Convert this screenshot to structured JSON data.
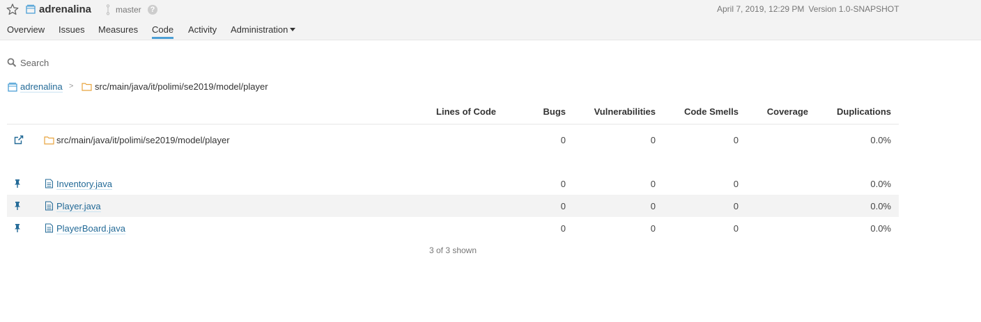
{
  "header": {
    "project_name": "adrenalina",
    "branch": "master",
    "help_label": "?",
    "date": "April 7, 2019, 12:29 PM",
    "version": "Version 1.0-SNAPSHOT"
  },
  "nav": {
    "tabs": [
      {
        "label": "Overview"
      },
      {
        "label": "Issues"
      },
      {
        "label": "Measures"
      },
      {
        "label": "Code",
        "active": true
      },
      {
        "label": "Activity"
      },
      {
        "label": "Administration"
      }
    ]
  },
  "search": {
    "placeholder": "Search"
  },
  "breadcrumb": {
    "root": "adrenalina",
    "separator": ">",
    "path": "src/main/java/it/polimi/se2019/model/player"
  },
  "table": {
    "columns": [
      "Lines of Code",
      "Bugs",
      "Vulnerabilities",
      "Code Smells",
      "Coverage",
      "Duplications"
    ],
    "base_row": {
      "name": "src/main/java/it/polimi/se2019/model/player",
      "bugs": "0",
      "vulnerabilities": "0",
      "code_smells": "0",
      "duplications": "0.0%"
    },
    "rows": [
      {
        "name": "Inventory.java",
        "bugs": "0",
        "vulnerabilities": "0",
        "code_smells": "0",
        "duplications": "0.0%"
      },
      {
        "name": "Player.java",
        "bugs": "0",
        "vulnerabilities": "0",
        "code_smells": "0",
        "duplications": "0.0%"
      },
      {
        "name": "PlayerBoard.java",
        "bugs": "0",
        "vulnerabilities": "0",
        "code_smells": "0",
        "duplications": "0.0%"
      }
    ],
    "footer": "3 of 3 shown"
  },
  "colors": {
    "accent": "#4b9fd5",
    "link": "#236a97",
    "folder": "#e8a33d",
    "pin": "#236a97"
  },
  "icons": [
    "star-icon",
    "project-icon",
    "branch-icon",
    "help-icon",
    "search-icon",
    "folder-icon",
    "external-link-icon",
    "pin-icon",
    "file-icon"
  ]
}
